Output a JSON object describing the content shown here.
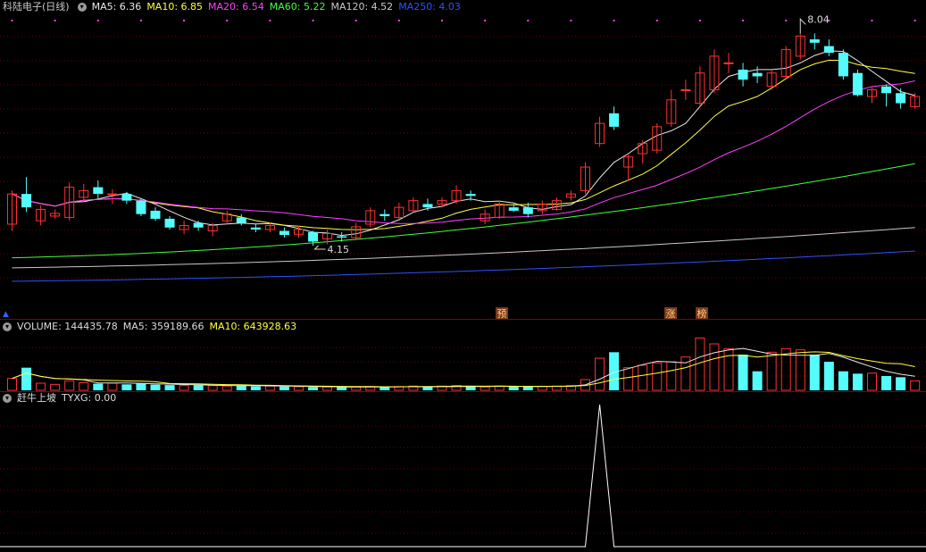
{
  "main": {
    "title": "科陆电子(日线)",
    "ma": [
      {
        "label": "MA5: 6.36",
        "color": "#e8e8e8"
      },
      {
        "label": "MA10: 6.85",
        "color": "#ffff40"
      },
      {
        "label": "MA20: 6.54",
        "color": "#ff40ff"
      },
      {
        "label": "MA60: 5.22",
        "color": "#40ff40"
      },
      {
        "label": "MA120: 4.52",
        "color": "#c8c8c8"
      },
      {
        "label": "MA250: 4.03",
        "color": "#3050ff"
      }
    ],
    "high_label": "8.04",
    "low_label": "4.15",
    "events": [
      "预",
      "涨",
      "榜"
    ]
  },
  "volume": {
    "title": "VOLUME: 144435.78",
    "ma5": "MA5: 359189.66",
    "ma10": "MA10: 643928.63"
  },
  "indicator": {
    "title": "赶牛上坡",
    "value": "TYXG: 0.00"
  },
  "chart_data": {
    "type": "candlestick",
    "ylim": [
      3.95,
      8.35
    ],
    "candles": [
      [
        5.2,
        5.65,
        5.7,
        5.1
      ],
      [
        5.65,
        5.45,
        5.9,
        5.38
      ],
      [
        5.25,
        5.42,
        5.48,
        5.18
      ],
      [
        5.32,
        5.36,
        5.42,
        5.28
      ],
      [
        5.3,
        5.75,
        5.82,
        5.25
      ],
      [
        5.6,
        5.7,
        5.8,
        5.55
      ],
      [
        5.75,
        5.65,
        5.85,
        5.58
      ],
      [
        5.65,
        5.65,
        5.72,
        5.5
      ],
      [
        5.65,
        5.55,
        5.68,
        5.5
      ],
      [
        5.55,
        5.35,
        5.58,
        5.32
      ],
      [
        5.4,
        5.28,
        5.45,
        5.25
      ],
      [
        5.28,
        5.15,
        5.32,
        5.12
      ],
      [
        5.12,
        5.18,
        5.25,
        5.05
      ],
      [
        5.22,
        5.15,
        5.25,
        5.1
      ],
      [
        5.1,
        5.18,
        5.22,
        5.02
      ],
      [
        5.25,
        5.35,
        5.4,
        5.2
      ],
      [
        5.3,
        5.22,
        5.35,
        5.18
      ],
      [
        5.15,
        5.12,
        5.2,
        5.08
      ],
      [
        5.12,
        5.18,
        5.22,
        5.08
      ],
      [
        5.1,
        5.04,
        5.15,
        5.0
      ],
      [
        5.05,
        5.12,
        5.18,
        5.0
      ],
      [
        5.08,
        4.94,
        5.1,
        4.88
      ],
      [
        4.98,
        5.06,
        5.12,
        4.9
      ],
      [
        5.02,
        5.0,
        5.08,
        4.94
      ],
      [
        5.0,
        5.16,
        5.22,
        4.98
      ],
      [
        5.2,
        5.4,
        5.45,
        5.15
      ],
      [
        5.35,
        5.32,
        5.42,
        5.25
      ],
      [
        5.3,
        5.45,
        5.52,
        5.28
      ],
      [
        5.4,
        5.55,
        5.6,
        5.38
      ],
      [
        5.5,
        5.45,
        5.58,
        5.4
      ],
      [
        5.5,
        5.55,
        5.6,
        5.45
      ],
      [
        5.55,
        5.7,
        5.78,
        5.5
      ],
      [
        5.65,
        5.62,
        5.7,
        5.55
      ],
      [
        5.25,
        5.35,
        5.42,
        5.2
      ],
      [
        5.3,
        5.5,
        5.55,
        5.28
      ],
      [
        5.45,
        5.4,
        5.5,
        5.38
      ],
      [
        5.45,
        5.35,
        5.52,
        5.3
      ],
      [
        5.4,
        5.5,
        5.55,
        5.35
      ],
      [
        5.42,
        5.55,
        5.6,
        5.4
      ],
      [
        5.6,
        5.65,
        5.7,
        5.55
      ],
      [
        5.7,
        6.05,
        6.12,
        5.65
      ],
      [
        6.4,
        6.7,
        6.8,
        6.35
      ],
      [
        6.85,
        6.65,
        6.95,
        6.6
      ],
      [
        6.05,
        6.2,
        6.25,
        5.85
      ],
      [
        6.25,
        6.4,
        6.45,
        6.1
      ],
      [
        6.3,
        6.65,
        6.7,
        6.25
      ],
      [
        6.7,
        7.05,
        7.2,
        6.65
      ],
      [
        7.2,
        7.2,
        7.35,
        7.05
      ],
      [
        7.0,
        7.45,
        7.55,
        6.95
      ],
      [
        7.2,
        7.7,
        7.8,
        7.15
      ],
      [
        7.6,
        7.6,
        7.75,
        7.45
      ],
      [
        7.5,
        7.35,
        7.6,
        7.25
      ],
      [
        7.45,
        7.4,
        7.55,
        7.3
      ],
      [
        7.25,
        7.45,
        7.5,
        7.2
      ],
      [
        7.4,
        7.8,
        7.85,
        7.35
      ],
      [
        7.7,
        8.0,
        8.04,
        7.65
      ],
      [
        7.95,
        7.9,
        8.04,
        7.8
      ],
      [
        7.85,
        7.75,
        7.95,
        7.7
      ],
      [
        7.75,
        7.4,
        7.8,
        7.35
      ],
      [
        7.45,
        7.12,
        7.5,
        7.1
      ],
      [
        7.1,
        7.2,
        7.25,
        7.0
      ],
      [
        7.25,
        7.15,
        7.28,
        6.95
      ],
      [
        7.15,
        7.0,
        7.22,
        6.92
      ],
      [
        6.95,
        7.1,
        7.15,
        6.92
      ]
    ],
    "volume": [
      0.5,
      0.95,
      0.3,
      0.25,
      0.4,
      0.32,
      0.28,
      0.3,
      0.25,
      0.3,
      0.24,
      0.22,
      0.2,
      0.22,
      0.2,
      0.18,
      0.2,
      0.17,
      0.18,
      0.16,
      0.15,
      0.14,
      0.14,
      0.13,
      0.14,
      0.16,
      0.14,
      0.16,
      0.18,
      0.16,
      0.18,
      0.2,
      0.18,
      0.14,
      0.18,
      0.16,
      0.15,
      0.17,
      0.18,
      0.2,
      0.45,
      1.35,
      1.6,
      0.95,
      1.05,
      1.15,
      1.2,
      1.4,
      2.2,
      1.95,
      1.75,
      1.5,
      0.8,
      1.6,
      1.75,
      1.7,
      1.5,
      1.2,
      0.8,
      0.7,
      0.72,
      0.6,
      0.55,
      0.4
    ],
    "volume_ylim": [
      0,
      2.4
    ],
    "indicator": {
      "values_note_index": 41,
      "peak_value": 1,
      "baseline": 0
    }
  }
}
